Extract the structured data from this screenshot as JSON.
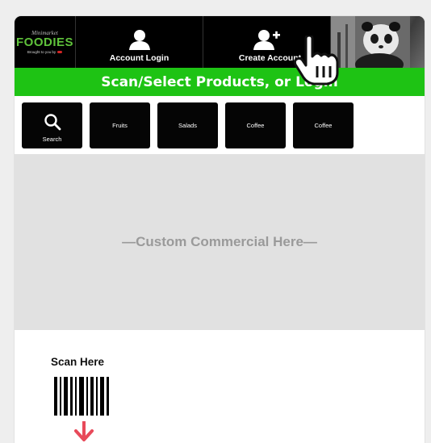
{
  "logo": {
    "top_text": "Minimarket",
    "main_text": "FOODIES",
    "sub_text": "Brought to you by"
  },
  "nav": {
    "account_login": "Account Login",
    "create_account": "Create Account",
    "account_icon": "person-icon",
    "create_icon": "person-add-icon"
  },
  "banner": {
    "title": "Scan/Select Products, or Login",
    "color": "#1ec314"
  },
  "categories": [
    {
      "label": "Search",
      "icon": "search-icon"
    },
    {
      "label": "Fruits"
    },
    {
      "label": "Salads"
    },
    {
      "label": "Coffee"
    },
    {
      "label": "Coffee"
    }
  ],
  "commercial": {
    "text": "—Custom Commercial Here—"
  },
  "scan": {
    "label": "Scan Here",
    "icon": "barcode-icon",
    "arrow_icon": "arrow-down-icon",
    "arrow_color": "#e84a5a"
  },
  "cursor": {
    "icon": "hand-pointer-icon"
  }
}
